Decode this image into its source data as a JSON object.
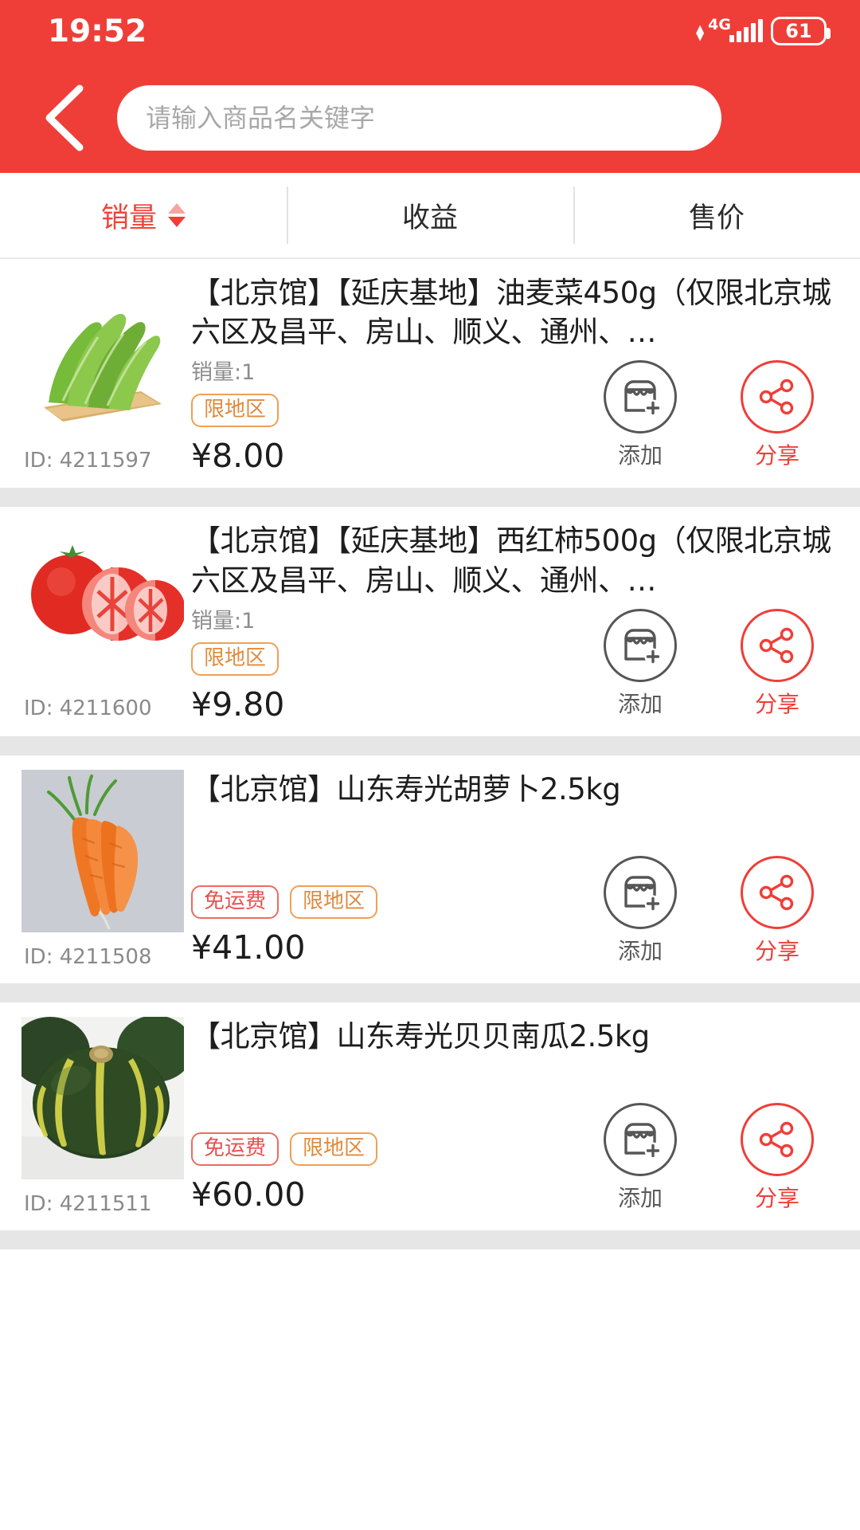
{
  "statusbar": {
    "time": "19:52",
    "network": "4G",
    "battery": "61"
  },
  "header": {
    "back_icon": "chevron-left-icon",
    "search_placeholder": "请输入商品名关键字",
    "search_value": "",
    "accent_color": "#ef3e38"
  },
  "tabs": [
    {
      "label": "销量",
      "active": true,
      "sort_icon": "sort-arrows-icon",
      "sort_dir": "desc"
    },
    {
      "label": "收益",
      "active": false
    },
    {
      "label": "售价",
      "active": false
    }
  ],
  "products": [
    {
      "title": "【北京馆】【延庆基地】油麦菜450g（仅限北京城六区及昌平、房山、顺义、通州、…",
      "sales": "销量:1",
      "tags": [
        {
          "text": "限地区",
          "type": "region"
        }
      ],
      "price": "¥8.00",
      "id": "ID: 4211597",
      "image": "lettuce",
      "add_label": "添加",
      "share_label": "分享"
    },
    {
      "title": "【北京馆】【延庆基地】西红柿500g（仅限北京城六区及昌平、房山、顺义、通州、…",
      "sales": "销量:1",
      "tags": [
        {
          "text": "限地区",
          "type": "region"
        }
      ],
      "price": "¥9.80",
      "id": "ID: 4211600",
      "image": "tomato",
      "add_label": "添加",
      "share_label": "分享"
    },
    {
      "title": "【北京馆】山东寿光胡萝卜2.5kg",
      "sales": "",
      "tags": [
        {
          "text": "免运费",
          "type": "free"
        },
        {
          "text": "限地区",
          "type": "region"
        }
      ],
      "price": "¥41.00",
      "id": "ID: 4211508",
      "image": "carrot",
      "add_label": "添加",
      "share_label": "分享"
    },
    {
      "title": "【北京馆】山东寿光贝贝南瓜2.5kg",
      "sales": "",
      "tags": [
        {
          "text": "免运费",
          "type": "free"
        },
        {
          "text": "限地区",
          "type": "region"
        }
      ],
      "price": "¥60.00",
      "id": "ID: 4211511",
      "image": "pumpkin",
      "add_label": "添加",
      "share_label": "分享"
    }
  ],
  "icons": {
    "add": "store-plus-icon",
    "share": "share-nodes-icon"
  }
}
